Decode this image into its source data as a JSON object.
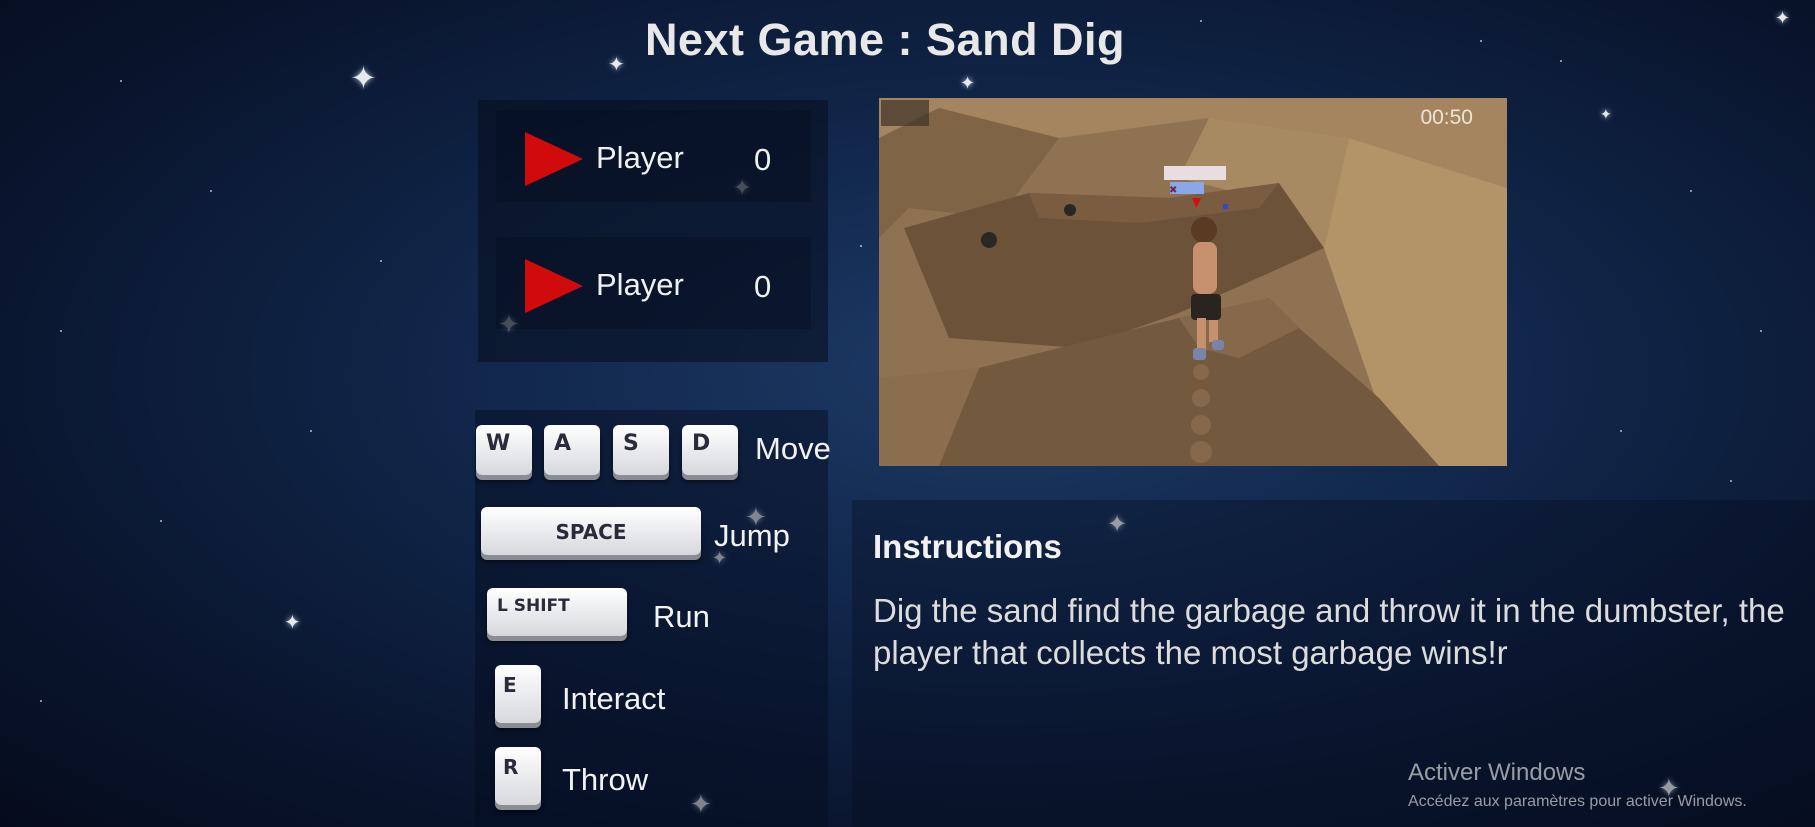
{
  "header": {
    "title": "Next Game : Sand Dig"
  },
  "players": [
    {
      "name": "Player",
      "score": "0",
      "marker_color": "#d10b0b"
    },
    {
      "name": "Player",
      "score": "0",
      "marker_color": "#d10b0b"
    }
  ],
  "controls": {
    "move": {
      "keys": [
        "W",
        "A",
        "S",
        "D"
      ],
      "label": "Move"
    },
    "jump": {
      "key": "SPACE",
      "label": "Jump"
    },
    "run": {
      "key": "L SHIFT",
      "label": "Run"
    },
    "interact": {
      "key": "E",
      "label": "Interact"
    },
    "throw": {
      "key": "R",
      "label": "Throw"
    }
  },
  "preview": {
    "timer": "00:50"
  },
  "instructions": {
    "title": "Instructions",
    "text": "Dig the sand find the garbage and throw it in the dumbster, the player that collects the most garbage wins!r"
  },
  "os_watermark": {
    "title": "Activer Windows",
    "subtitle": "Accédez aux paramètres pour activer Windows."
  }
}
